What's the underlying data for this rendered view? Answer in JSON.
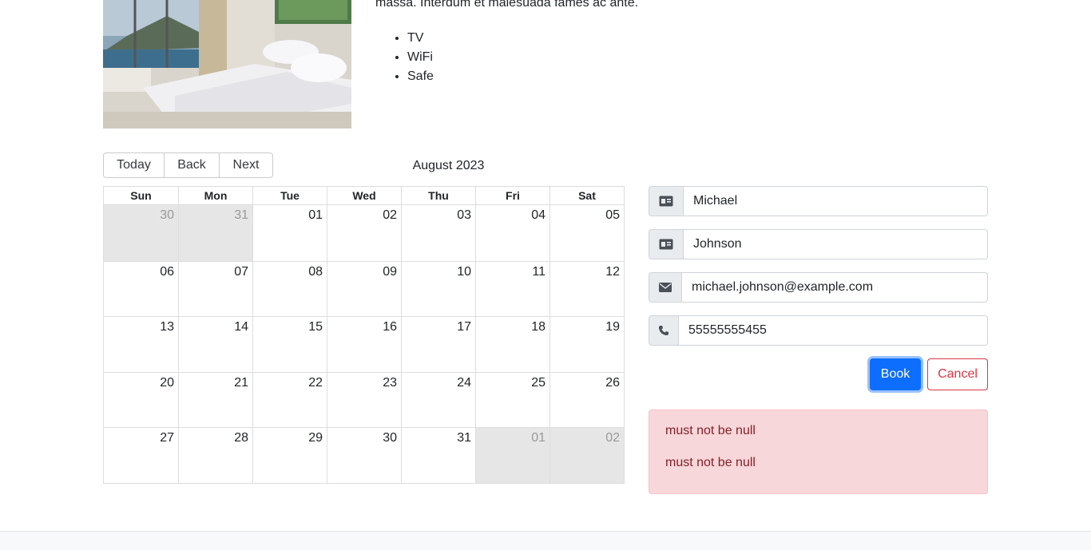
{
  "room": {
    "description_fragment": "massa. Interdum et malesuada fames ac ante.",
    "features": [
      "TV",
      "WiFi",
      "Safe"
    ]
  },
  "calendar": {
    "toolbar": {
      "today": "Today",
      "back": "Back",
      "next": "Next"
    },
    "label": "August 2023",
    "weekdays": [
      "Sun",
      "Mon",
      "Tue",
      "Wed",
      "Thu",
      "Fri",
      "Sat"
    ],
    "weeks": [
      [
        {
          "d": "30",
          "off": true
        },
        {
          "d": "31",
          "off": true
        },
        {
          "d": "01"
        },
        {
          "d": "02"
        },
        {
          "d": "03"
        },
        {
          "d": "04"
        },
        {
          "d": "05"
        }
      ],
      [
        {
          "d": "06"
        },
        {
          "d": "07"
        },
        {
          "d": "08"
        },
        {
          "d": "09"
        },
        {
          "d": "10"
        },
        {
          "d": "11"
        },
        {
          "d": "12"
        }
      ],
      [
        {
          "d": "13"
        },
        {
          "d": "14"
        },
        {
          "d": "15"
        },
        {
          "d": "16"
        },
        {
          "d": "17"
        },
        {
          "d": "18"
        },
        {
          "d": "19"
        }
      ],
      [
        {
          "d": "20"
        },
        {
          "d": "21"
        },
        {
          "d": "22"
        },
        {
          "d": "23"
        },
        {
          "d": "24"
        },
        {
          "d": "25"
        },
        {
          "d": "26"
        }
      ],
      [
        {
          "d": "27"
        },
        {
          "d": "28"
        },
        {
          "d": "29"
        },
        {
          "d": "30"
        },
        {
          "d": "31"
        },
        {
          "d": "01",
          "off": true
        },
        {
          "d": "02",
          "off": true
        }
      ]
    ]
  },
  "form": {
    "firstname": {
      "value": "Michael",
      "icon": "id-card-icon"
    },
    "lastname": {
      "value": "Johnson",
      "icon": "id-card-icon"
    },
    "email": {
      "value": "michael.johnson@example.com",
      "icon": "envelope-icon"
    },
    "phone": {
      "value": "55555555455",
      "icon": "phone-icon"
    },
    "book_label": "Book",
    "cancel_label": "Cancel"
  },
  "alert": {
    "messages": [
      "must not be null",
      "must not be null"
    ]
  },
  "colors": {
    "primary": "#0d6efd",
    "danger": "#dc3545",
    "alert_bg": "#f8d7da",
    "off_day": "#e6e6e6"
  }
}
